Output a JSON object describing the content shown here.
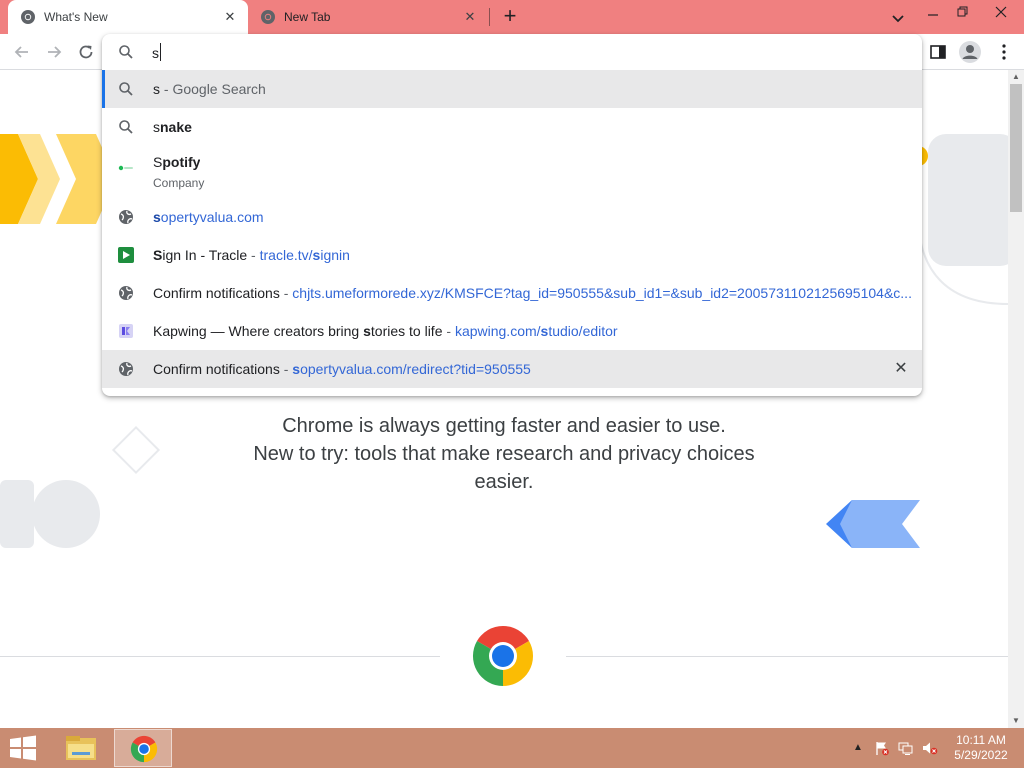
{
  "tabs": [
    {
      "title": "What's New",
      "active": true,
      "close": "✕"
    },
    {
      "title": "New Tab",
      "active": false,
      "close": "✕"
    }
  ],
  "tabstrip": {
    "new_tab": "+",
    "bg_color": "#f08080"
  },
  "toolbar": {
    "icons": [
      "back-arrow-icon",
      "forward-arrow-icon",
      "reload-icon",
      "side-panel-icon",
      "profile-icon",
      "kebab-menu-icon"
    ]
  },
  "omnibox": {
    "input_value": "s",
    "suggestions": [
      {
        "icon": "search-icon",
        "typed": "s",
        "rest": "",
        "separator": " - ",
        "desc": "Google Search",
        "selected": true
      },
      {
        "icon": "search-icon",
        "typed": "s",
        "rest": "nake"
      },
      {
        "icon": "spotify-icon",
        "typed": "S",
        "rest": "potify",
        "subtitle": "Company"
      },
      {
        "icon": "globe-icon",
        "url_typed": "s",
        "url_rest": "opertyvalua.com"
      },
      {
        "icon": "tracle-icon",
        "typed": "S",
        "rest": "ign In - Tracle",
        "separator": " - ",
        "url_pre": "tracle.tv/",
        "url_typed": "s",
        "url_rest": "ignin"
      },
      {
        "icon": "globe-icon",
        "title": "Confirm notifications",
        "separator": " - ",
        "url": "chjts.umeformorede.xyz/KMSFCE?tag_id=950555&sub_id1=&sub_id2=2005731102125695104&c..."
      },
      {
        "icon": "kapwing-icon",
        "title_pre": "Kapwing — Where creators bring ",
        "typed": "s",
        "rest": "tories to life",
        "separator": " - ",
        "url_pre": "kapwing.com/",
        "url_typed": "s",
        "url_rest": "tudio/editor"
      },
      {
        "icon": "globe-icon",
        "title": "Confirm notifications",
        "separator": " - ",
        "url_typed": "s",
        "url_rest": "opertyvalua.com/redirect?tid=950555",
        "remove": "✕",
        "hovered": true
      }
    ]
  },
  "page": {
    "hero_line1": "Chrome is always getting faster and easier to use.",
    "hero_line2": "New to try: tools that make research and privacy choices",
    "hero_line3": "easier."
  },
  "scrollbar": {
    "up": "▲",
    "down": "▼"
  },
  "taskbar": {
    "tray_arrow": "▲",
    "time": "10:11 AM",
    "date": "5/29/2022",
    "color": "#c98c72"
  }
}
